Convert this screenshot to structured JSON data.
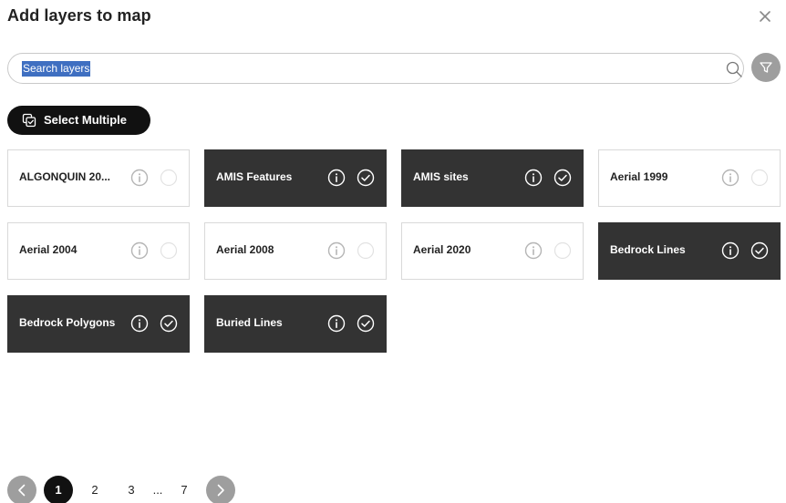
{
  "dialog": {
    "title": "Add layers to map"
  },
  "search": {
    "value": "Search layers"
  },
  "toolbar": {
    "select_multiple_label": "Select Multiple"
  },
  "layers": [
    {
      "label": "ALGONQUIN 20...",
      "selected": false
    },
    {
      "label": "AMIS Features",
      "selected": true
    },
    {
      "label": "AMIS sites",
      "selected": true
    },
    {
      "label": "Aerial 1999",
      "selected": false
    },
    {
      "label": "Aerial 2004",
      "selected": false
    },
    {
      "label": "Aerial 2008",
      "selected": false
    },
    {
      "label": "Aerial 2020",
      "selected": false
    },
    {
      "label": "Bedrock Lines",
      "selected": true
    },
    {
      "label": "Bedrock Polygons",
      "selected": true
    },
    {
      "label": "Buried Lines",
      "selected": true
    }
  ],
  "pagination": {
    "pages": [
      "1",
      "2",
      "3",
      "...",
      "7"
    ],
    "current": "1"
  },
  "colors": {
    "selected_card": "#333333",
    "search_highlight": "#3f6fc1",
    "nav_button": "#9e9e9e"
  },
  "icons": {
    "close": "close-icon",
    "search": "search-icon",
    "filter": "filter-icon",
    "select_multiple": "multi-select-icon",
    "info": "info-icon",
    "check": "check-circle-icon",
    "prev": "chevron-left-icon",
    "next": "chevron-right-icon"
  }
}
